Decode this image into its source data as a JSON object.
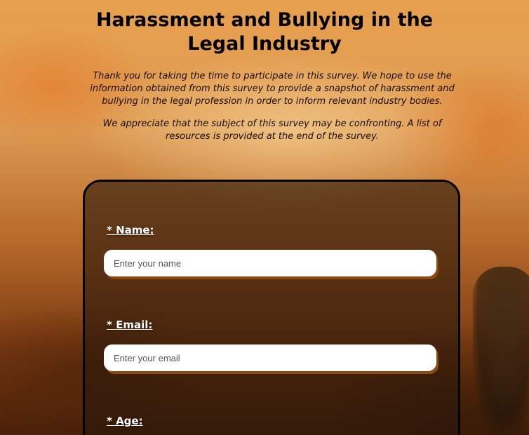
{
  "page": {
    "title_line1": "Harassment and Bullying in the",
    "title_line2": "Legal Industry",
    "intro_paragraph1": "Thank you for taking the time to participate in this survey. We hope to use the information obtained from this survey to provide a snapshot of harassment and bullying in the legal profession in order to inform relevant industry bodies.",
    "intro_paragraph2": "We appreciate that the subject of this survey may be confronting. A list of resources is provided at the end of the survey."
  },
  "form": {
    "name": {
      "label": "* Name:",
      "placeholder": "Enter your name",
      "value": ""
    },
    "email": {
      "label": "* Email:",
      "placeholder": "Enter your email",
      "value": ""
    },
    "age": {
      "label": "* Age:"
    }
  }
}
